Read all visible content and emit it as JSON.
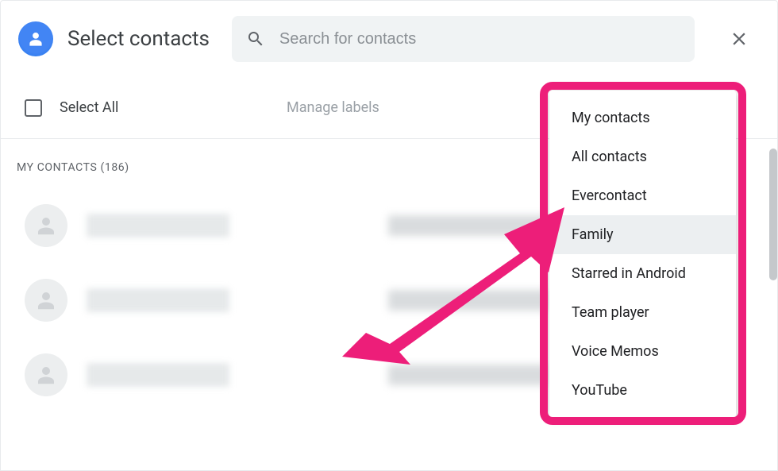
{
  "header": {
    "title": "Select contacts",
    "search_placeholder": "Search for contacts"
  },
  "toolbar": {
    "select_all_label": "Select All",
    "manage_labels_label": "Manage labels"
  },
  "section": {
    "title": "MY CONTACTS (186)"
  },
  "dropdown": {
    "items": [
      {
        "label": "My contacts"
      },
      {
        "label": "All contacts"
      },
      {
        "label": "Evercontact"
      },
      {
        "label": "Family"
      },
      {
        "label": "Starred in Android"
      },
      {
        "label": "Team player"
      },
      {
        "label": "Voice Memos"
      },
      {
        "label": "YouTube"
      }
    ],
    "highlighted_index": 3
  },
  "colors": {
    "annotation": "#ed1e79",
    "primary": "#1a73e8"
  }
}
